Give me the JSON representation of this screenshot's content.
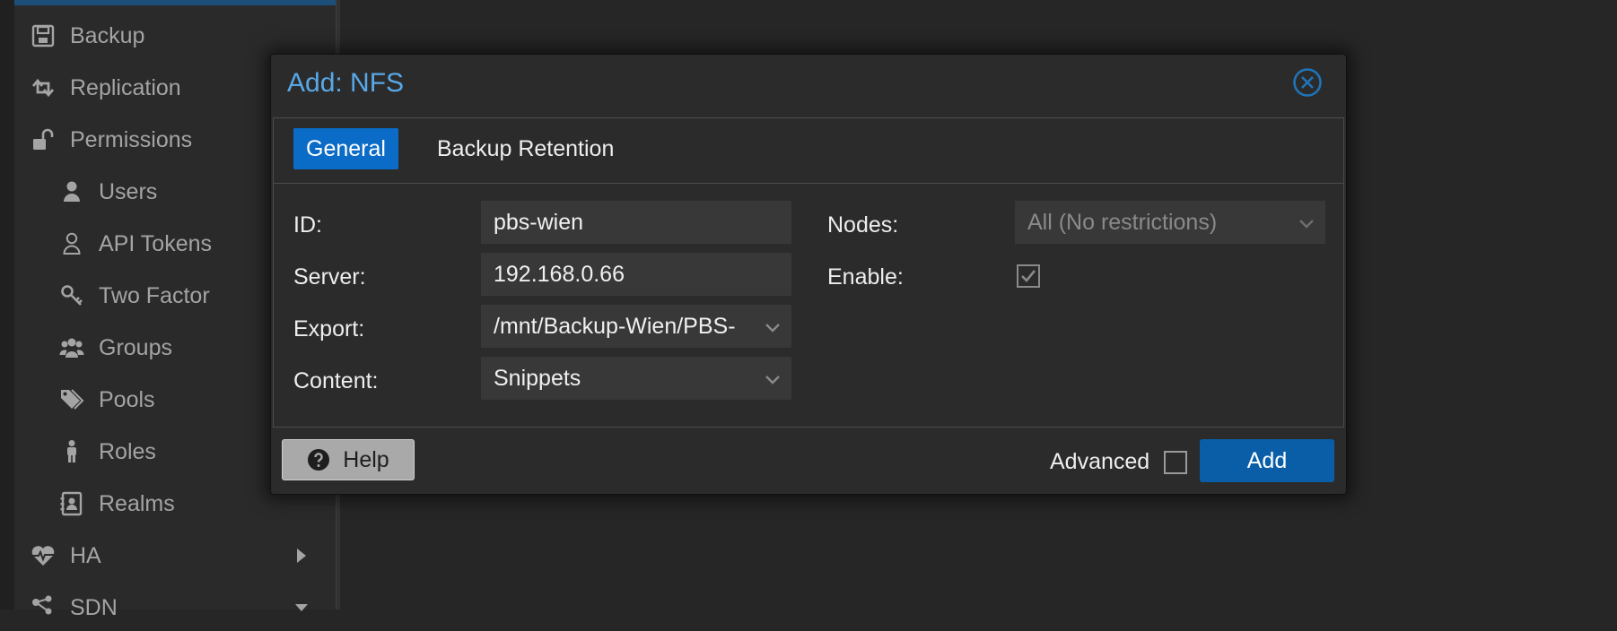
{
  "sidebar": {
    "items": [
      {
        "label": "Backup",
        "icon": "floppy-disk-icon"
      },
      {
        "label": "Replication",
        "icon": "retweet-arrows-icon"
      },
      {
        "label": "Permissions",
        "icon": "unlock-icon"
      },
      {
        "label": "Users",
        "icon": "user-icon"
      },
      {
        "label": "API Tokens",
        "icon": "user-outline-icon"
      },
      {
        "label": "Two Factor",
        "icon": "key-icon"
      },
      {
        "label": "Groups",
        "icon": "users-icon"
      },
      {
        "label": "Pools",
        "icon": "tags-icon"
      },
      {
        "label": "Roles",
        "icon": "male-icon"
      },
      {
        "label": "Realms",
        "icon": "address-book-icon"
      },
      {
        "label": "HA",
        "icon": "heartbeat-icon"
      },
      {
        "label": "SDN",
        "icon": "sitemap-icon"
      }
    ]
  },
  "dialog": {
    "title": "Add: NFS",
    "tabs": [
      {
        "label": "General",
        "active": true
      },
      {
        "label": "Backup Retention",
        "active": false
      }
    ],
    "fields": {
      "id_label": "ID:",
      "id_value": "pbs-wien",
      "server_label": "Server:",
      "server_value": "192.168.0.66",
      "export_label": "Export:",
      "export_value": "/mnt/Backup-Wien/PBS-",
      "content_label": "Content:",
      "content_value": "Snippets",
      "nodes_label": "Nodes:",
      "nodes_value": "All (No restrictions)",
      "enable_label": "Enable:",
      "enable_checked": true
    },
    "footer": {
      "help_label": "Help",
      "advanced_label": "Advanced",
      "advanced_checked": false,
      "add_label": "Add"
    }
  },
  "colors": {
    "accent_title": "#58a8e8",
    "tab_active_bg": "#0a6cc6",
    "add_button_bg": "#0a5ea8",
    "background": "#262626"
  }
}
